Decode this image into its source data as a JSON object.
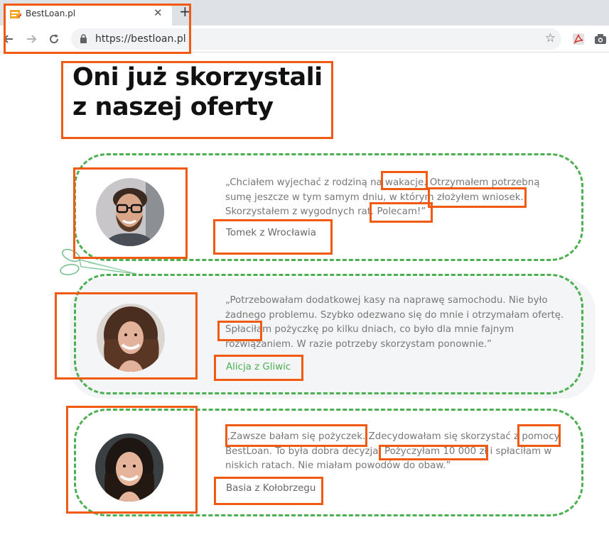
{
  "browser": {
    "tab_title": "BestLoan.pl",
    "tab_close": "✕",
    "new_tab": "+",
    "url": "https://bestloan.pl",
    "star": "☆"
  },
  "page": {
    "title_line1": "Oni już skorzystali",
    "title_line2": "z naszej oferty"
  },
  "testimonials": [
    {
      "quote": "„Chciałem wyjechać z rodziną na wakacje. Otrzymałem potrzebną sumę jeszcze w tym samym dniu, w którym złożyłem wniosek. Skorzystałem z wygodnych rat. Polecam!”",
      "author": "Tomek z Wrocławia",
      "avatar": "man-with-glasses"
    },
    {
      "quote": "„Potrzebowałam dodatkowej kasy na naprawę samochodu. Nie było żadnego problemu. Szybko odezwano się do mnie i otrzymałam ofertę. Spłaciłam pożyczkę po kilku dniach, co było dla mnie fajnym rozwiązaniem. W razie potrzeby skorzystam ponownie.”",
      "author": "Alicja z Gliwic",
      "avatar": "woman-curly-hair"
    },
    {
      "quote": "„Zawsze bałam się pożyczek. Zdecydowałam się skorzystać z pomocy BestLoan. To była dobra decyzja. Pożyczyłam 10 000 zł i spłaciłam w niskich ratach. Nie miałam powodów do obaw.”",
      "author": "Basia z Kołobrzegu",
      "avatar": "woman-dark-hair"
    }
  ],
  "colors": {
    "accent_green": "#4caf50",
    "highlight_orange": "#f15a12"
  }
}
